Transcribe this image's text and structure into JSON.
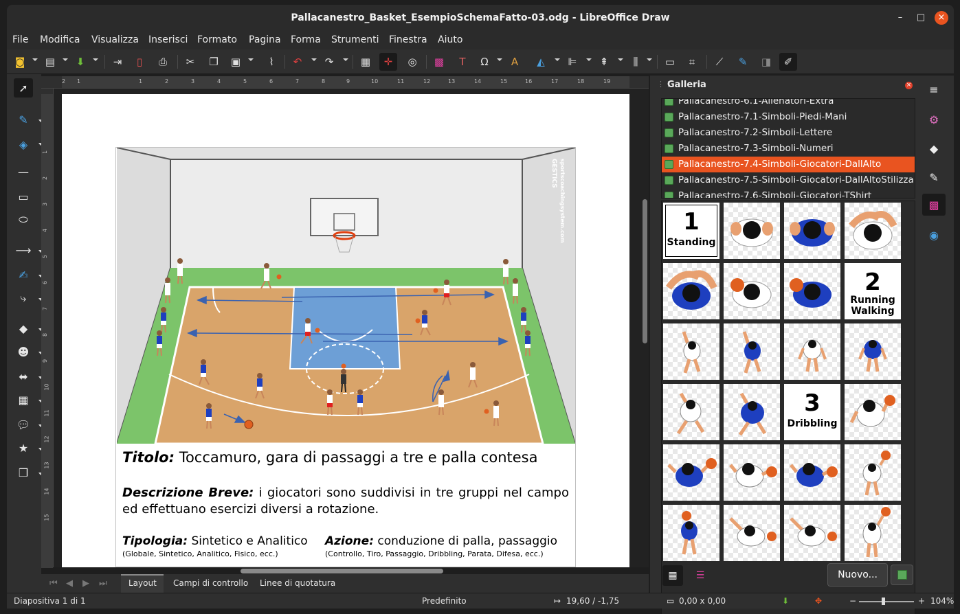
{
  "window": {
    "title": "Pallacanestro_Basket_EsempioSchemaFatto-03.odg - LibreOffice Draw",
    "minimize": "–",
    "maximize": "□",
    "close": "×"
  },
  "menu": [
    "File",
    "Modifica",
    "Visualizza",
    "Inserisci",
    "Formato",
    "Pagina",
    "Forma",
    "Strumenti",
    "Finestra",
    "Aiuto"
  ],
  "hruler_ticks": [
    "2",
    "1",
    "1",
    "2",
    "3",
    "4",
    "5",
    "6",
    "7",
    "8",
    "9",
    "10",
    "11",
    "12",
    "13",
    "14",
    "15",
    "16",
    "17",
    "18",
    "19"
  ],
  "vruler_ticks": [
    "1",
    "2",
    "3",
    "4",
    "5",
    "6",
    "7",
    "8",
    "9",
    "10",
    "11",
    "12",
    "13",
    "14",
    "15"
  ],
  "document": {
    "watermark": "sportscoachingsystem.com",
    "watermark2": "GESTICS",
    "titolo_label": "Titolo:",
    "titolo": "Toccamuro, gara di passaggi a tre e palla contesa",
    "descrizione_label": "Descrizione Breve:",
    "descrizione": "i giocatori sono suddivisi in tre gruppi nel campo ed effettuano esercizi diversi a rotazione.",
    "tipologia_label": "Tipologia:",
    "tipologia": "Sintetico e Analitico",
    "tipologia_hint": "(Globale, Sintetico, Analitico, Fisico, ecc.)",
    "azione_label": "Azione:",
    "azione": "conduzione di palla, passaggio",
    "azione_hint": "(Controllo, Tiro, Passaggio, Dribbling, Parata, Difesa, ecc.)"
  },
  "tabs": [
    "Layout",
    "Campi di controllo",
    "Linee di quotatura"
  ],
  "gallery": {
    "title": "Galleria",
    "themes": [
      "Pallacanestro-6.1-Allenatori-Extra",
      "Pallacanestro-7.1-Simboli-Piedi-Mani",
      "Pallacanestro-7.2-Simboli-Lettere",
      "Pallacanestro-7.3-Simboli-Numeri",
      "Pallacanestro-7.4-Simboli-Giocatori-DallAlto",
      "Pallacanestro-7.5-Simboli-Giocatori-DallAltoStilizza",
      "Pallacanestro-7.6-Simboli-Giocatori-TShirt"
    ],
    "selected_theme": 4,
    "labels": {
      "n1": "1",
      "l1": "Standing",
      "n2": "2",
      "l2a": "Running",
      "l2b": "Walking",
      "n3": "3",
      "l3": "Dribbling"
    },
    "new_button": "Nuovo..."
  },
  "status": {
    "slide": "Diapositiva 1 di 1",
    "layout": "Predefinito",
    "position": "19,60 / -1,75",
    "size": "0,00 x 0,00",
    "zoom": "104%"
  },
  "colors": {
    "accent": "#e95420",
    "blue_team": "#1e3fbf",
    "red_team": "#e02020",
    "court_wood": "#d9a46a",
    "paint": "#6d9fd6",
    "green_out": "#7cc46a"
  }
}
